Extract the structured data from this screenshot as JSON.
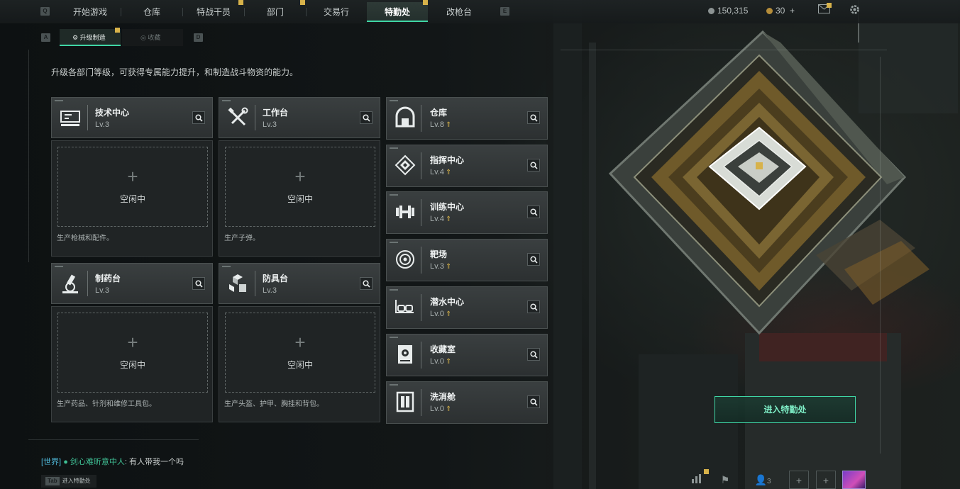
{
  "nav": {
    "q_key": "Q",
    "e_key": "E",
    "tabs": [
      {
        "label": "开始游戏"
      },
      {
        "label": "仓库"
      },
      {
        "label": "特战干员"
      },
      {
        "label": "部门"
      },
      {
        "label": "交易行"
      },
      {
        "label": "特勤处",
        "active": true
      },
      {
        "label": "改枪台"
      }
    ]
  },
  "currency": {
    "coins": "150,315",
    "tickets": "30",
    "add": "+"
  },
  "subtabs": {
    "a_key": "A",
    "d_key": "D",
    "items": [
      {
        "label": "升级制造",
        "active": true
      },
      {
        "label": "收藏"
      }
    ]
  },
  "description": "升级各部门等级，可获得专属能力提升，和制造战斗物资的能力。",
  "production": [
    {
      "title": "技术中心",
      "level": "Lv.3",
      "status": "空闲中",
      "desc": "生产枪械和配件。",
      "icon": "computer-icon"
    },
    {
      "title": "工作台",
      "level": "Lv.3",
      "status": "空闲中",
      "desc": "生产子弹。",
      "icon": "tools-icon"
    },
    {
      "title": "制药台",
      "level": "Lv.3",
      "status": "空闲中",
      "desc": "生产药品、针剂和维修工具包。",
      "icon": "microscope-icon"
    },
    {
      "title": "防具台",
      "level": "Lv.3",
      "status": "空闲中",
      "desc": "生产头盔、护甲、胸挂和背包。",
      "icon": "boxes-icon"
    }
  ],
  "plus_symbol": "+",
  "departments": [
    {
      "title": "仓库",
      "level": "Lv.8",
      "icon": "warehouse-icon"
    },
    {
      "title": "指挥中心",
      "level": "Lv.4",
      "icon": "command-icon"
    },
    {
      "title": "训练中心",
      "level": "Lv.4",
      "icon": "dumbbell-icon"
    },
    {
      "title": "靶场",
      "level": "Lv.3",
      "icon": "target-icon"
    },
    {
      "title": "潜水中心",
      "level": "Lv.0",
      "icon": "diving-mask-icon"
    },
    {
      "title": "收藏室",
      "level": "Lv.0",
      "icon": "vault-icon"
    },
    {
      "title": "洗消舱",
      "level": "Lv.0",
      "icon": "decon-pod-icon"
    }
  ],
  "upgrade_arrow": "⇑",
  "enter_button": "进入特勤处",
  "chat": {
    "channel": "[世界]",
    "sender": "剑心难昕意中人",
    "message": "有人带我一个吗"
  },
  "tab_hint": {
    "key": "Tab",
    "label": "进入特勤处"
  },
  "bottom": {
    "friends_count": "3",
    "plus": "+"
  },
  "colors": {
    "accent": "#3fd6a5",
    "upgrade": "#d7b24a",
    "chat_channel": "#4fb8d8"
  }
}
